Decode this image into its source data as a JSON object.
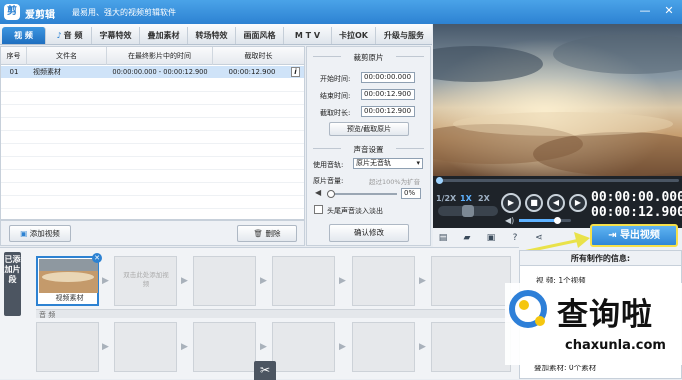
{
  "titlebar": {
    "logo_glyph": "剪",
    "app_name": "爱剪辑",
    "slogan": "最易用、强大的视频剪辑软件",
    "min": "—",
    "close": "✕"
  },
  "tabs": [
    {
      "label": "视 频",
      "active": true,
      "icon": "film-icon"
    },
    {
      "label": "音 频"
    },
    {
      "label": "字幕特效"
    },
    {
      "label": "叠加素材"
    },
    {
      "label": "转场特效"
    },
    {
      "label": "画面风格"
    },
    {
      "label": "M T V"
    },
    {
      "label": "卡拉OK"
    },
    {
      "label": "升级与服务"
    }
  ],
  "table": {
    "headers": [
      "序号",
      "文件名",
      "在最终影片中的时间",
      "截取时长"
    ],
    "rows": [
      {
        "index": "01",
        "filename": "视频素材",
        "time_in_film": "00:00:00.000 - 00:00:12.900",
        "duration": "00:00:12.900",
        "info": "i"
      }
    ]
  },
  "left_buttons": {
    "add_video": "添加视频",
    "delete": "删除"
  },
  "clip_panel": {
    "title": "裁剪原片",
    "start_label": "开始时间:",
    "start_value": "00:00:00.000",
    "end_label": "结束时间:",
    "end_value": "00:00:12.900",
    "duration_label": "截取时长:",
    "duration_value": "00:00:12.900",
    "preview_button": "预览/截取原片",
    "audio_title": "声音设置",
    "track_label": "使用音轨:",
    "track_value": "原片无音轨",
    "volume_label": "原片音量:",
    "volume_hint": "超过100%为扩音",
    "volume_value": "0%",
    "fade_label": "头尾声音淡入淡出",
    "confirm_button": "确认修改"
  },
  "player": {
    "speeds": [
      "1/2X",
      "1X",
      "2X"
    ],
    "current_time": "00:00:00.000",
    "total_time": "00:00:12.900",
    "seek_progress": 0,
    "volume_level": 0.72
  },
  "export_button": "导出视频",
  "timeline": {
    "side_tab": "已添加片段",
    "clips": [
      {
        "label": "视频素材"
      },
      {
        "hint": "双击此处添加视频"
      },
      {},
      {},
      {},
      {},
      {}
    ],
    "audio_label": "音 频",
    "scissors": "✂"
  },
  "info_panel": {
    "title": "所有制作的信息:",
    "video_key": "视 频:",
    "video_value": "1个视频",
    "overlay_key": "叠加素材:",
    "overlay_value": "0个素材"
  },
  "watermark": {
    "text": "查询啦",
    "url": "chaxunla.com"
  },
  "colors": {
    "titlebar": "#2d82d2",
    "accent": "#2d82d2",
    "export_border": "#f6e04a",
    "arrow": "#e9e24a",
    "player_bg": "#1e2329"
  }
}
